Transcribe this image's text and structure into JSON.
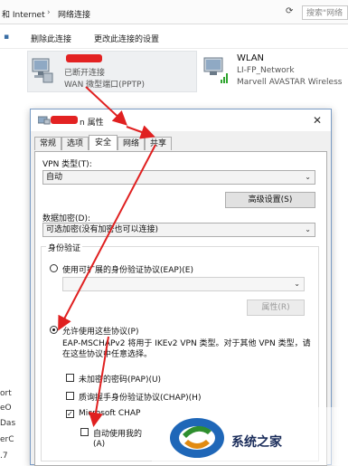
{
  "explorer": {
    "breadcrumb_prefix": "和 Internet",
    "breadcrumb_current": "网络连接",
    "search_placeholder": "搜索\"网络",
    "commands": [
      "删除此连接",
      "更改此连接的设置"
    ],
    "vpn_adapter": {
      "name": "",
      "status": "已断开连接",
      "device": "WAN 微型端口(PPTP)"
    },
    "wlan_adapter": {
      "name": "WLAN",
      "network": "LI-FP_Network",
      "device": "Marvell AVASTAR Wireless"
    },
    "left_fragments": [
      "ort",
      "eO",
      "Das",
      "erC",
      ".7"
    ]
  },
  "dialog": {
    "title_suffix": "n 属性",
    "close_label": "✕",
    "tabs": [
      "常规",
      "选项",
      "安全",
      "网络",
      "共享"
    ],
    "selected_tab": "安全",
    "vpn_type_label": "VPN 类型(T):",
    "vpn_type_value": "自动",
    "advanced_button": "高级设置(S)",
    "encryption_label": "数据加密(D):",
    "encryption_value": "可选加密(没有加密也可以连接)",
    "auth_group_label": "身份验证",
    "eap_radio_label": "使用可扩展的身份验证协议(EAP)(E)",
    "properties_button": "属性(R)",
    "allow_radio_label": "允许使用这些协议(P)",
    "eap_note": "EAP-MSCHAPv2 将用于 IKEv2 VPN 类型。对于其他 VPN 类型，请在这些协议中任意选择。",
    "protocols": [
      {
        "label": "未加密的密码(PAP)(U)",
        "checked": false
      },
      {
        "label": "质询握手身份验证协议(CHAP)(H)",
        "checked": false
      },
      {
        "label": "Microsoft CHAP",
        "checked": true
      }
    ],
    "sub_option_label": "自动使用我的",
    "sub_option_suffix": "(A)"
  },
  "watermark": {
    "text": "系统之家"
  },
  "colors": {
    "arrow_red": "#e02020",
    "dialog_border": "#7a9cc6",
    "wlan_signal": "#2fa52f"
  }
}
